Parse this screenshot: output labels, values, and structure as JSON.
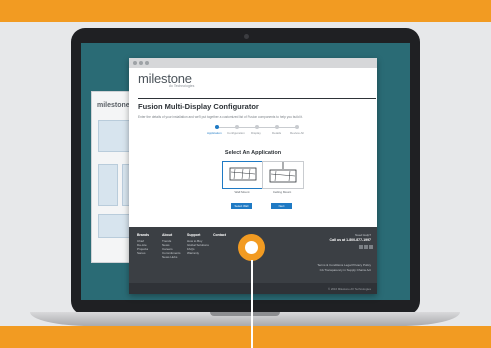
{
  "colors": {
    "background": "#f29b22",
    "screen": "#2a6b75",
    "accent": "#1f7ac4",
    "footer": "#3b3f44"
  },
  "brand": {
    "name": "milestone",
    "tagline": "Av Technologies"
  },
  "back_window": {
    "brand": "milestone"
  },
  "page": {
    "title": "Fusion Multi-Display Configurator",
    "intro": "Enter the details of your installation and we'll put together a customized list of Fusion components to help you build it."
  },
  "steps": [
    {
      "label": "Application",
      "active": true
    },
    {
      "label": "Configuration",
      "active": false
    },
    {
      "label": "Display",
      "active": false
    },
    {
      "label": "Details",
      "active": false
    },
    {
      "label": "Review All",
      "active": false
    }
  ],
  "section": {
    "title": "Select An Application"
  },
  "options": [
    {
      "label": "Wall Mount",
      "icon": "wall-mount-icon",
      "selected": true
    },
    {
      "label": "Ceiling Mount",
      "icon": "ceiling-mount-icon",
      "selected": false
    }
  ],
  "buttons": {
    "left": "Select Wall",
    "right": "Next"
  },
  "footer": {
    "columns": [
      {
        "title": "Brands",
        "items": [
          "Chief",
          "Da-Lite",
          "Projecta",
          "Sanus"
        ]
      },
      {
        "title": "About",
        "items": [
          "Trends",
          "News",
          "Careers",
          "Commitments",
          "News Hubs"
        ]
      },
      {
        "title": "Support",
        "items": [
          "How to Buy",
          "Global Solutions",
          "FAQs",
          "Warranty"
        ]
      },
      {
        "title": "Contact",
        "items": []
      }
    ],
    "need_help": "Need Help?",
    "phone": "Call us at 1-800-877-1997",
    "links": [
      "Terms & Conditions",
      "Legal",
      "Privacy Policy"
    ],
    "ca_note": "CA Transparency in Supply Chains Act",
    "copyright": "© 2016 Milestone AV Technologies"
  }
}
